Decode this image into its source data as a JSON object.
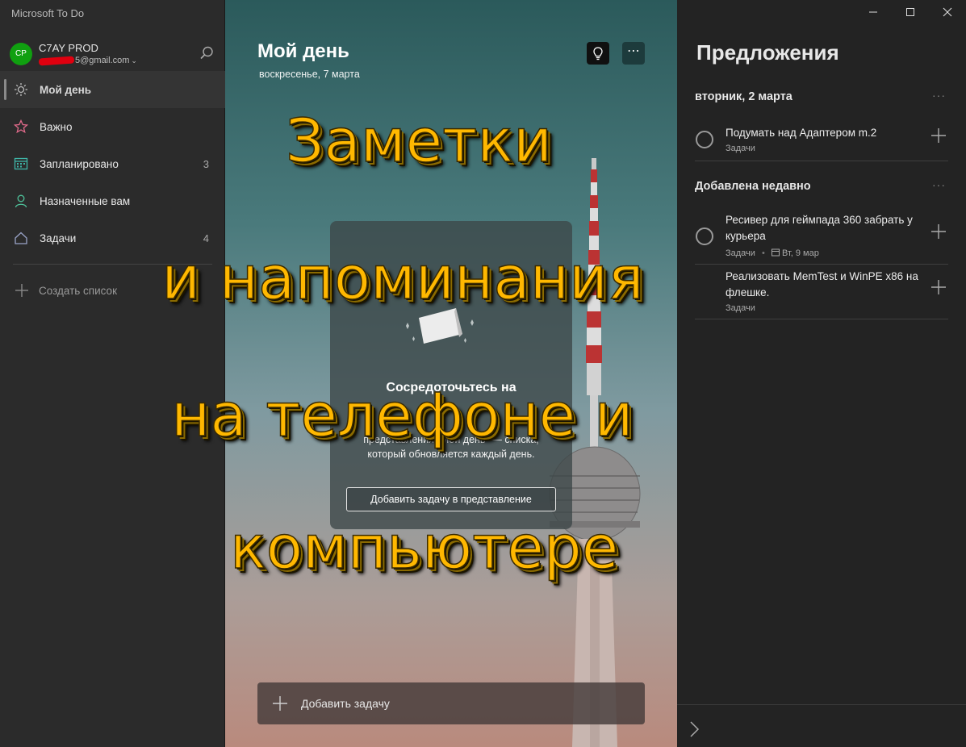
{
  "app": {
    "title": "Microsoft To Do"
  },
  "account": {
    "initials": "CP",
    "name": "C7AY PROD",
    "email_visible": "5@gmail.com"
  },
  "sidebar": {
    "items": [
      {
        "label": "Мой день",
        "count": "",
        "icon": "sun-icon",
        "active": true
      },
      {
        "label": "Важно",
        "count": "",
        "icon": "star-icon"
      },
      {
        "label": "Запланировано",
        "count": "3",
        "icon": "calendar-icon"
      },
      {
        "label": "Назначенные вам",
        "count": "",
        "icon": "person-icon"
      },
      {
        "label": "Задачи",
        "count": "4",
        "icon": "home-icon"
      }
    ],
    "create_list": "Создать список"
  },
  "main": {
    "title": "Мой день",
    "date": "воскресенье, 7 марта",
    "focus": {
      "title": "Сосредоточьтесь на",
      "desc_line1": "представления \"Мой день\" — списка,",
      "desc_line2": "который обновляется каждый день.",
      "button": "Добавить задачу в представление"
    },
    "add_task": "Добавить задачу"
  },
  "suggestions": {
    "title": "Предложения",
    "groups": [
      {
        "title": "вторник, 2 марта",
        "items": [
          {
            "text": "Подумать над Адаптером m.2",
            "list": "Задачи",
            "due": ""
          }
        ]
      },
      {
        "title": "Добавлена недавно",
        "items": [
          {
            "text": "Ресивер для геймпада 360 забрать у курьера",
            "list": "Задачи",
            "due": "Вт, 9 мар"
          },
          {
            "text": "Реализовать MemTest и WinPE x86 на флешке.",
            "list": "Задачи",
            "due": ""
          }
        ]
      }
    ]
  },
  "overlay": {
    "line1": "Заметки",
    "line2": "и напоминания",
    "line3": "на телефоне и",
    "line4": "компьютере",
    "color": "#ffb800"
  }
}
